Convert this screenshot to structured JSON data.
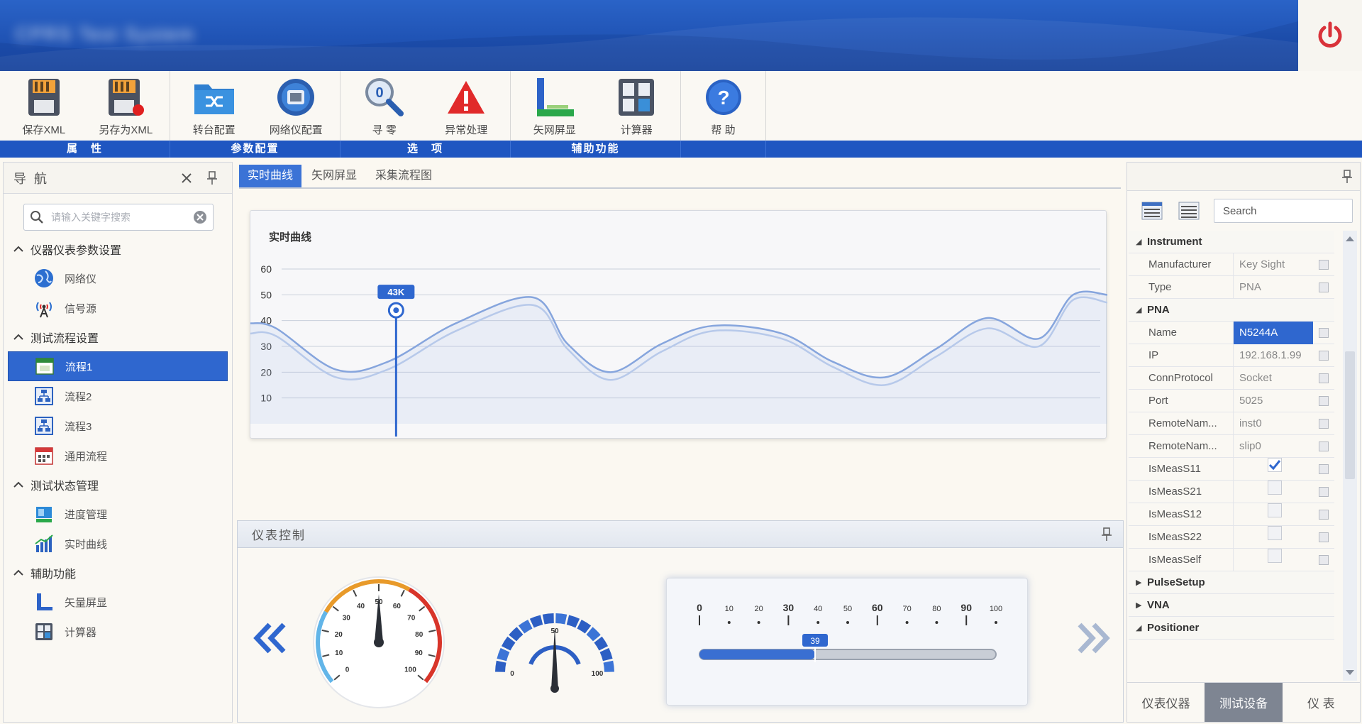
{
  "app": {
    "title": "CPRS Test System"
  },
  "ribbon": {
    "buttons": [
      {
        "label": "保存XML",
        "icon": "save-xml-icon"
      },
      {
        "label": "另存为XML",
        "icon": "save-as-xml-icon"
      },
      {
        "label": "转台配置",
        "icon": "turntable-config-icon"
      },
      {
        "label": "网络仪配置",
        "icon": "network-analyzer-config-icon"
      },
      {
        "label": "寻 零",
        "icon": "find-zero-icon"
      },
      {
        "label": "异常处理",
        "icon": "exception-warning-icon"
      },
      {
        "label": "矢网屏显",
        "icon": "vna-display-icon"
      },
      {
        "label": "计算器",
        "icon": "calculator-icon"
      },
      {
        "label": "帮 助",
        "icon": "help-icon"
      }
    ],
    "groups": [
      "属　性",
      "参数配置",
      "选　项",
      "辅助功能"
    ]
  },
  "nav": {
    "title": "导 航",
    "search_placeholder": "请输入关键字搜索",
    "sections": [
      {
        "label": "仪器仪表参数设置",
        "items": [
          "网络仪",
          "信号源"
        ]
      },
      {
        "label": "测试流程设置",
        "items": [
          "流程1",
          "流程2",
          "流程3",
          "通用流程"
        ]
      },
      {
        "label": "测试状态管理",
        "items": [
          "进度管理",
          "实时曲线"
        ]
      },
      {
        "label": "辅助功能",
        "items": [
          "矢量屏显",
          "计算器"
        ]
      }
    ],
    "selected": "流程1"
  },
  "tabs": [
    "实时曲线",
    "矢网屏显",
    "采集流程图"
  ],
  "active_tab": "实时曲线",
  "chart_data": {
    "type": "line",
    "title": "实时曲线",
    "ylim": [
      0,
      60
    ],
    "yticks": [
      10,
      20,
      30,
      40,
      50,
      60
    ],
    "xlim": [
      0,
      100
    ],
    "grid": true,
    "series": [
      {
        "x": [
          0,
          3,
          10,
          16,
          24,
          33,
          37,
          42,
          48,
          54,
          62,
          68,
          74,
          80,
          86,
          92,
          96,
          100
        ],
        "values": [
          39,
          37,
          21,
          24,
          39,
          49,
          31,
          20,
          31,
          38,
          35,
          24,
          18,
          29,
          41,
          33,
          50,
          50
        ]
      },
      {
        "x": [
          0,
          3,
          10,
          16,
          24,
          33,
          37,
          42,
          48,
          54,
          62,
          68,
          74,
          80,
          86,
          92,
          96,
          100
        ],
        "values": [
          35,
          34,
          18,
          21,
          36,
          46,
          29,
          17,
          28,
          36,
          33,
          22,
          15,
          26,
          37,
          30,
          48,
          47
        ]
      }
    ],
    "marker": {
      "x": 17,
      "label": "43K"
    }
  },
  "control": {
    "title": "仪表控制",
    "gauge1": {
      "ticks": [
        "0",
        "10",
        "20",
        "30",
        "40",
        "50",
        "60",
        "70",
        "80",
        "90",
        "100"
      ],
      "value": 50
    },
    "gauge2": {
      "ticks": [
        "0",
        "50",
        "100"
      ],
      "value": 50
    },
    "slider": {
      "ticks": [
        "0",
        "10",
        "20",
        "30",
        "40",
        "50",
        "60",
        "70",
        "80",
        "90",
        "100"
      ],
      "value": 39,
      "value_label": "39"
    }
  },
  "props": {
    "search_placeholder": "Search",
    "categories": [
      {
        "name": "Instrument",
        "expanded": true,
        "rows": [
          {
            "key": "Manufacturer",
            "value": "Key Sight"
          },
          {
            "key": "Type",
            "value": "PNA"
          }
        ]
      },
      {
        "name": "PNA",
        "expanded": true,
        "rows": [
          {
            "key": "Name",
            "value": "N5244A"
          },
          {
            "key": "IP",
            "value": "192.168.1.99"
          },
          {
            "key": "ConnProtocol",
            "value": "Socket"
          },
          {
            "key": "Port",
            "value": "5025"
          },
          {
            "key": "RemoteNam...",
            "value": "inst0"
          },
          {
            "key": "RemoteNam...",
            "value": "slip0"
          },
          {
            "key": "IsMeasS11",
            "checked": true
          },
          {
            "key": "IsMeasS21",
            "checked": false
          },
          {
            "key": "IsMeasS12",
            "checked": false
          },
          {
            "key": "IsMeasS22",
            "checked": false
          },
          {
            "key": "IsMeasSelf",
            "checked": false
          }
        ]
      },
      {
        "name": "PulseSetup",
        "expanded": false
      },
      {
        "name": "VNA",
        "expanded": false
      },
      {
        "name": "Positioner",
        "expanded": true
      }
    ],
    "tabs": [
      "仪表仪器",
      "测试设备",
      "仪 表"
    ],
    "active_tab": "测试设备"
  },
  "colors": {
    "accent": "#2f67cf",
    "ribbon_bar": "#1f56c1",
    "title_bar": "#2a63c7",
    "power": "#d9323a"
  }
}
